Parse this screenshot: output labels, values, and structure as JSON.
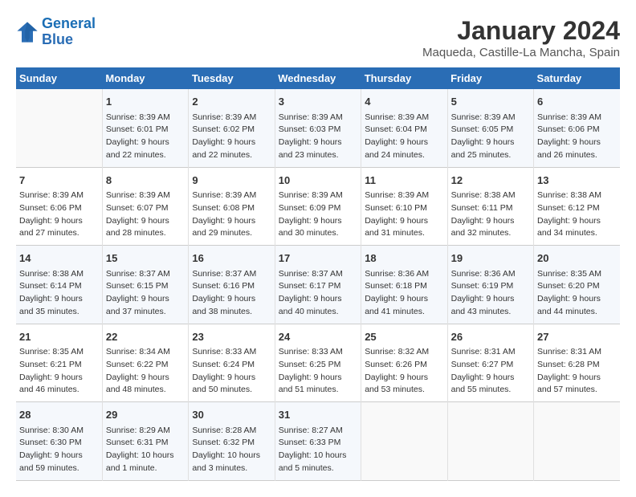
{
  "header": {
    "logo_line1": "General",
    "logo_line2": "Blue",
    "title": "January 2024",
    "subtitle": "Maqueda, Castille-La Mancha, Spain"
  },
  "days_of_week": [
    "Sunday",
    "Monday",
    "Tuesday",
    "Wednesday",
    "Thursday",
    "Friday",
    "Saturday"
  ],
  "weeks": [
    [
      {
        "day": "",
        "content": ""
      },
      {
        "day": "1",
        "sunrise": "Sunrise: 8:39 AM",
        "sunset": "Sunset: 6:01 PM",
        "daylight": "Daylight: 9 hours and 22 minutes."
      },
      {
        "day": "2",
        "sunrise": "Sunrise: 8:39 AM",
        "sunset": "Sunset: 6:02 PM",
        "daylight": "Daylight: 9 hours and 22 minutes."
      },
      {
        "day": "3",
        "sunrise": "Sunrise: 8:39 AM",
        "sunset": "Sunset: 6:03 PM",
        "daylight": "Daylight: 9 hours and 23 minutes."
      },
      {
        "day": "4",
        "sunrise": "Sunrise: 8:39 AM",
        "sunset": "Sunset: 6:04 PM",
        "daylight": "Daylight: 9 hours and 24 minutes."
      },
      {
        "day": "5",
        "sunrise": "Sunrise: 8:39 AM",
        "sunset": "Sunset: 6:05 PM",
        "daylight": "Daylight: 9 hours and 25 minutes."
      },
      {
        "day": "6",
        "sunrise": "Sunrise: 8:39 AM",
        "sunset": "Sunset: 6:06 PM",
        "daylight": "Daylight: 9 hours and 26 minutes."
      }
    ],
    [
      {
        "day": "7",
        "sunrise": "Sunrise: 8:39 AM",
        "sunset": "Sunset: 6:06 PM",
        "daylight": "Daylight: 9 hours and 27 minutes."
      },
      {
        "day": "8",
        "sunrise": "Sunrise: 8:39 AM",
        "sunset": "Sunset: 6:07 PM",
        "daylight": "Daylight: 9 hours and 28 minutes."
      },
      {
        "day": "9",
        "sunrise": "Sunrise: 8:39 AM",
        "sunset": "Sunset: 6:08 PM",
        "daylight": "Daylight: 9 hours and 29 minutes."
      },
      {
        "day": "10",
        "sunrise": "Sunrise: 8:39 AM",
        "sunset": "Sunset: 6:09 PM",
        "daylight": "Daylight: 9 hours and 30 minutes."
      },
      {
        "day": "11",
        "sunrise": "Sunrise: 8:39 AM",
        "sunset": "Sunset: 6:10 PM",
        "daylight": "Daylight: 9 hours and 31 minutes."
      },
      {
        "day": "12",
        "sunrise": "Sunrise: 8:38 AM",
        "sunset": "Sunset: 6:11 PM",
        "daylight": "Daylight: 9 hours and 32 minutes."
      },
      {
        "day": "13",
        "sunrise": "Sunrise: 8:38 AM",
        "sunset": "Sunset: 6:12 PM",
        "daylight": "Daylight: 9 hours and 34 minutes."
      }
    ],
    [
      {
        "day": "14",
        "sunrise": "Sunrise: 8:38 AM",
        "sunset": "Sunset: 6:14 PM",
        "daylight": "Daylight: 9 hours and 35 minutes."
      },
      {
        "day": "15",
        "sunrise": "Sunrise: 8:37 AM",
        "sunset": "Sunset: 6:15 PM",
        "daylight": "Daylight: 9 hours and 37 minutes."
      },
      {
        "day": "16",
        "sunrise": "Sunrise: 8:37 AM",
        "sunset": "Sunset: 6:16 PM",
        "daylight": "Daylight: 9 hours and 38 minutes."
      },
      {
        "day": "17",
        "sunrise": "Sunrise: 8:37 AM",
        "sunset": "Sunset: 6:17 PM",
        "daylight": "Daylight: 9 hours and 40 minutes."
      },
      {
        "day": "18",
        "sunrise": "Sunrise: 8:36 AM",
        "sunset": "Sunset: 6:18 PM",
        "daylight": "Daylight: 9 hours and 41 minutes."
      },
      {
        "day": "19",
        "sunrise": "Sunrise: 8:36 AM",
        "sunset": "Sunset: 6:19 PM",
        "daylight": "Daylight: 9 hours and 43 minutes."
      },
      {
        "day": "20",
        "sunrise": "Sunrise: 8:35 AM",
        "sunset": "Sunset: 6:20 PM",
        "daylight": "Daylight: 9 hours and 44 minutes."
      }
    ],
    [
      {
        "day": "21",
        "sunrise": "Sunrise: 8:35 AM",
        "sunset": "Sunset: 6:21 PM",
        "daylight": "Daylight: 9 hours and 46 minutes."
      },
      {
        "day": "22",
        "sunrise": "Sunrise: 8:34 AM",
        "sunset": "Sunset: 6:22 PM",
        "daylight": "Daylight: 9 hours and 48 minutes."
      },
      {
        "day": "23",
        "sunrise": "Sunrise: 8:33 AM",
        "sunset": "Sunset: 6:24 PM",
        "daylight": "Daylight: 9 hours and 50 minutes."
      },
      {
        "day": "24",
        "sunrise": "Sunrise: 8:33 AM",
        "sunset": "Sunset: 6:25 PM",
        "daylight": "Daylight: 9 hours and 51 minutes."
      },
      {
        "day": "25",
        "sunrise": "Sunrise: 8:32 AM",
        "sunset": "Sunset: 6:26 PM",
        "daylight": "Daylight: 9 hours and 53 minutes."
      },
      {
        "day": "26",
        "sunrise": "Sunrise: 8:31 AM",
        "sunset": "Sunset: 6:27 PM",
        "daylight": "Daylight: 9 hours and 55 minutes."
      },
      {
        "day": "27",
        "sunrise": "Sunrise: 8:31 AM",
        "sunset": "Sunset: 6:28 PM",
        "daylight": "Daylight: 9 hours and 57 minutes."
      }
    ],
    [
      {
        "day": "28",
        "sunrise": "Sunrise: 8:30 AM",
        "sunset": "Sunset: 6:30 PM",
        "daylight": "Daylight: 9 hours and 59 minutes."
      },
      {
        "day": "29",
        "sunrise": "Sunrise: 8:29 AM",
        "sunset": "Sunset: 6:31 PM",
        "daylight": "Daylight: 10 hours and 1 minute."
      },
      {
        "day": "30",
        "sunrise": "Sunrise: 8:28 AM",
        "sunset": "Sunset: 6:32 PM",
        "daylight": "Daylight: 10 hours and 3 minutes."
      },
      {
        "day": "31",
        "sunrise": "Sunrise: 8:27 AM",
        "sunset": "Sunset: 6:33 PM",
        "daylight": "Daylight: 10 hours and 5 minutes."
      },
      {
        "day": "",
        "content": ""
      },
      {
        "day": "",
        "content": ""
      },
      {
        "day": "",
        "content": ""
      }
    ]
  ]
}
